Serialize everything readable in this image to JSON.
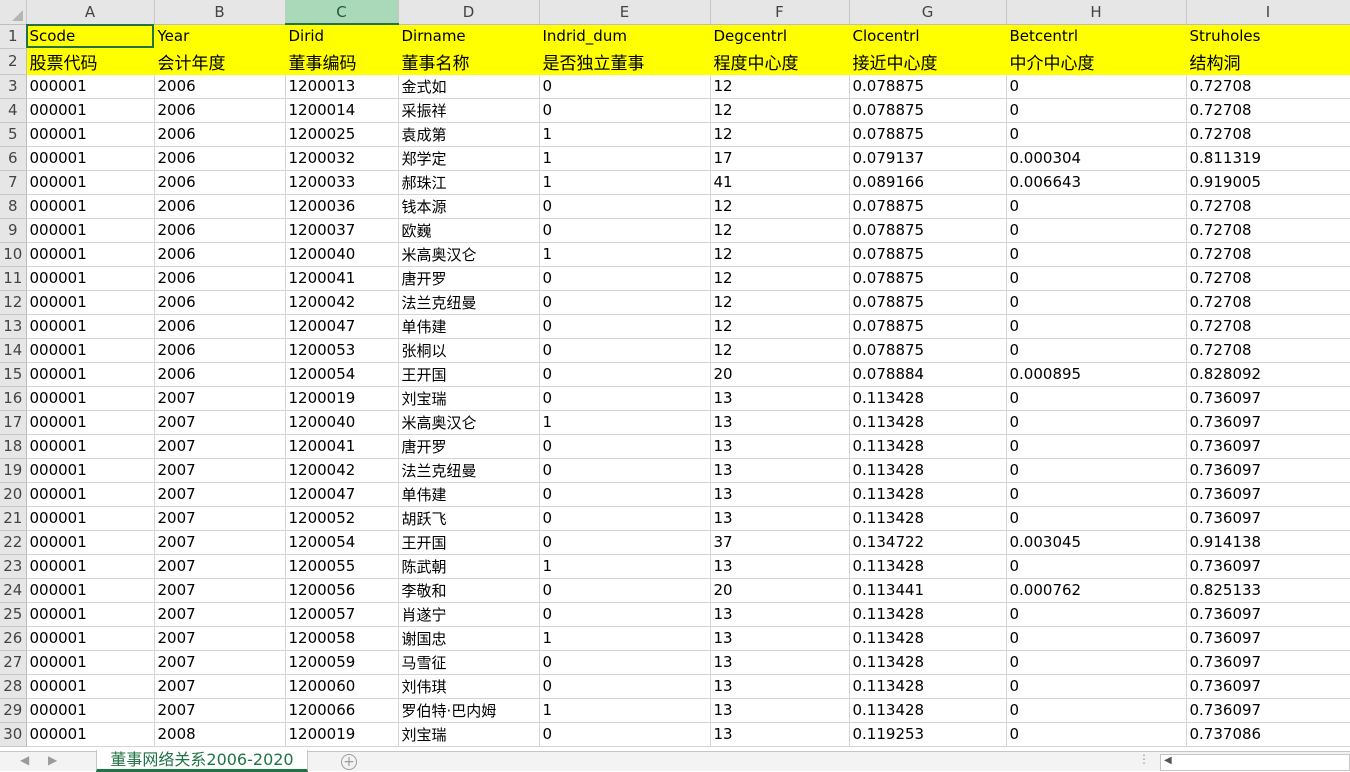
{
  "columns": [
    "A",
    "B",
    "C",
    "D",
    "E",
    "F",
    "G",
    "H",
    "I"
  ],
  "active_column": "C",
  "selected_cell": "A1",
  "header_row": [
    "Scode",
    "Year",
    "Dirid",
    "Dirname",
    "Indrid_dum",
    "Degcentrl",
    "Clocentrl",
    "Betcentrl",
    "Struholes"
  ],
  "header_row_cn": [
    "股票代码",
    "会计年度",
    "董事编码",
    "董事名称",
    "是否独立董事",
    "程度中心度",
    "接近中心度",
    "中介中心度",
    "结构洞"
  ],
  "rows": [
    [
      "000001",
      "2006",
      "1200013",
      "金式如",
      "0",
      "12",
      "0.078875",
      "0",
      "0.72708"
    ],
    [
      "000001",
      "2006",
      "1200014",
      "采振祥",
      "0",
      "12",
      "0.078875",
      "0",
      "0.72708"
    ],
    [
      "000001",
      "2006",
      "1200025",
      "袁成第",
      "1",
      "12",
      "0.078875",
      "0",
      "0.72708"
    ],
    [
      "000001",
      "2006",
      "1200032",
      "郑学定",
      "1",
      "17",
      "0.079137",
      "0.000304",
      "0.811319"
    ],
    [
      "000001",
      "2006",
      "1200033",
      "郝珠江",
      "1",
      "41",
      "0.089166",
      "0.006643",
      "0.919005"
    ],
    [
      "000001",
      "2006",
      "1200036",
      "钱本源",
      "0",
      "12",
      "0.078875",
      "0",
      "0.72708"
    ],
    [
      "000001",
      "2006",
      "1200037",
      "欧巍",
      "0",
      "12",
      "0.078875",
      "0",
      "0.72708"
    ],
    [
      "000001",
      "2006",
      "1200040",
      "米高奥汉仑",
      "1",
      "12",
      "0.078875",
      "0",
      "0.72708"
    ],
    [
      "000001",
      "2006",
      "1200041",
      "唐开罗",
      "0",
      "12",
      "0.078875",
      "0",
      "0.72708"
    ],
    [
      "000001",
      "2006",
      "1200042",
      "法兰克纽曼",
      "0",
      "12",
      "0.078875",
      "0",
      "0.72708"
    ],
    [
      "000001",
      "2006",
      "1200047",
      "单伟建",
      "0",
      "12",
      "0.078875",
      "0",
      "0.72708"
    ],
    [
      "000001",
      "2006",
      "1200053",
      "张桐以",
      "0",
      "12",
      "0.078875",
      "0",
      "0.72708"
    ],
    [
      "000001",
      "2006",
      "1200054",
      "王开国",
      "0",
      "20",
      "0.078884",
      "0.000895",
      "0.828092"
    ],
    [
      "000001",
      "2007",
      "1200019",
      "刘宝瑞",
      "0",
      "13",
      "0.113428",
      "0",
      "0.736097"
    ],
    [
      "000001",
      "2007",
      "1200040",
      "米高奥汉仑",
      "1",
      "13",
      "0.113428",
      "0",
      "0.736097"
    ],
    [
      "000001",
      "2007",
      "1200041",
      "唐开罗",
      "0",
      "13",
      "0.113428",
      "0",
      "0.736097"
    ],
    [
      "000001",
      "2007",
      "1200042",
      "法兰克纽曼",
      "0",
      "13",
      "0.113428",
      "0",
      "0.736097"
    ],
    [
      "000001",
      "2007",
      "1200047",
      "单伟建",
      "0",
      "13",
      "0.113428",
      "0",
      "0.736097"
    ],
    [
      "000001",
      "2007",
      "1200052",
      "胡跃飞",
      "0",
      "13",
      "0.113428",
      "0",
      "0.736097"
    ],
    [
      "000001",
      "2007",
      "1200054",
      "王开国",
      "0",
      "37",
      "0.134722",
      "0.003045",
      "0.914138"
    ],
    [
      "000001",
      "2007",
      "1200055",
      "陈武朝",
      "1",
      "13",
      "0.113428",
      "0",
      "0.736097"
    ],
    [
      "000001",
      "2007",
      "1200056",
      "李敬和",
      "0",
      "20",
      "0.113441",
      "0.000762",
      "0.825133"
    ],
    [
      "000001",
      "2007",
      "1200057",
      "肖遂宁",
      "0",
      "13",
      "0.113428",
      "0",
      "0.736097"
    ],
    [
      "000001",
      "2007",
      "1200058",
      "谢国忠",
      "1",
      "13",
      "0.113428",
      "0",
      "0.736097"
    ],
    [
      "000001",
      "2007",
      "1200059",
      "马雪征",
      "0",
      "13",
      "0.113428",
      "0",
      "0.736097"
    ],
    [
      "000001",
      "2007",
      "1200060",
      "刘伟琪",
      "0",
      "13",
      "0.113428",
      "0",
      "0.736097"
    ],
    [
      "000001",
      "2007",
      "1200066",
      "罗伯特·巴内姆",
      "1",
      "13",
      "0.113428",
      "0",
      "0.736097"
    ],
    [
      "000001",
      "2008",
      "1200019",
      "刘宝瑞",
      "0",
      "13",
      "0.119253",
      "0",
      "0.737086"
    ]
  ],
  "sheet_tab": "董事网络关系2006-2020",
  "icons": {
    "prev_sheet": "◀",
    "next_sheet": "▶",
    "add_sheet": "+",
    "more": "⋮",
    "scroll_left": "◀"
  },
  "colors": {
    "header_highlight": "#ffff00",
    "selection": "#217346",
    "tab_text": "#217346"
  }
}
